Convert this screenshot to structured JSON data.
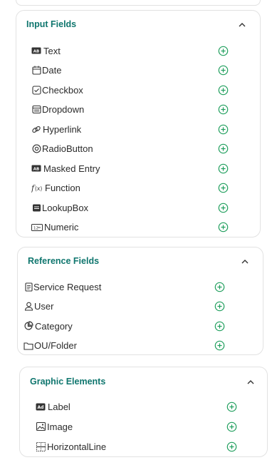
{
  "sections": [
    {
      "title": "Input Fields",
      "items": [
        {
          "label": "Text",
          "icon": "text-field-icon"
        },
        {
          "label": "Date",
          "icon": "calendar-icon"
        },
        {
          "label": "Checkbox",
          "icon": "checkbox-icon"
        },
        {
          "label": "Dropdown",
          "icon": "dropdown-icon"
        },
        {
          "label": "Hyperlink",
          "icon": "link-icon"
        },
        {
          "label": "RadioButton",
          "icon": "radio-icon"
        },
        {
          "label": "Masked Entry",
          "icon": "masked-entry-icon"
        },
        {
          "label": "Function",
          "icon": "function-icon"
        },
        {
          "label": "LookupBox",
          "icon": "lookup-icon"
        },
        {
          "label": "Numeric",
          "icon": "numeric-icon"
        }
      ]
    },
    {
      "title": "Reference Fields",
      "items": [
        {
          "label": "Service Request",
          "icon": "document-icon"
        },
        {
          "label": "User",
          "icon": "user-icon"
        },
        {
          "label": "Category",
          "icon": "category-icon"
        },
        {
          "label": "OU/Folder",
          "icon": "folder-icon"
        }
      ]
    },
    {
      "title": "Graphic Elements",
      "items": [
        {
          "label": "Label",
          "icon": "label-icon"
        },
        {
          "label": "Image",
          "icon": "image-icon"
        },
        {
          "label": "HorizontalLine",
          "icon": "horizontal-line-icon"
        }
      ]
    }
  ],
  "colors": {
    "accent": "#0f766e",
    "add_icon": "#1e9e5c",
    "border": "#e2e2e2",
    "text": "#2b2b2b"
  }
}
